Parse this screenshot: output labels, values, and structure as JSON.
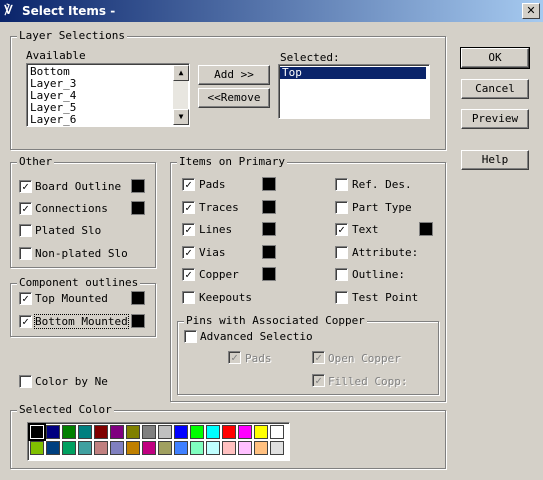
{
  "title": "Select Items -",
  "layer_selections": {
    "legend": "Layer Selections",
    "available_label": "Available",
    "available_items": [
      "Bottom",
      "Layer_3",
      "Layer_4",
      "Layer_5",
      "Layer_6"
    ],
    "selected_label": "Selected:",
    "selected_items": [
      "Top"
    ],
    "add_label": "Add >>",
    "remove_label": "<<Remove"
  },
  "buttons": {
    "ok": "OK",
    "cancel": "Cancel",
    "preview": "Preview",
    "help": "Help"
  },
  "other": {
    "legend": "Other",
    "items": [
      {
        "label": "Board Outline",
        "checked": true,
        "swatch": true
      },
      {
        "label": "Connections",
        "checked": true,
        "swatch": true
      },
      {
        "label": "Plated Slo",
        "checked": false,
        "swatch": false
      },
      {
        "label": "Non-plated Slo",
        "checked": false,
        "swatch": false
      }
    ]
  },
  "component_outlines": {
    "legend": "Component outlines",
    "items": [
      {
        "label": "Top Mounted",
        "checked": true
      },
      {
        "label": "Bottom Mounted",
        "checked": true
      }
    ]
  },
  "color_by_net": {
    "label": "Color by Ne",
    "checked": false
  },
  "items_on_primary": {
    "legend": "Items on Primary",
    "left": [
      {
        "label": "Pads",
        "checked": true
      },
      {
        "label": "Traces",
        "checked": true
      },
      {
        "label": "Lines",
        "checked": true
      },
      {
        "label": "Vias",
        "checked": true
      },
      {
        "label": "Copper",
        "checked": true
      },
      {
        "label": "Keepouts",
        "checked": false
      }
    ],
    "right": [
      {
        "label": "Ref. Des.",
        "checked": false
      },
      {
        "label": "Part Type",
        "checked": false
      },
      {
        "label": "Text",
        "checked": true
      },
      {
        "label": "Attribute:",
        "checked": false
      },
      {
        "label": "Outline:",
        "checked": false
      },
      {
        "label": "Test Point",
        "checked": false
      }
    ]
  },
  "pins_copper": {
    "legend": "Pins with Associated Copper",
    "advanced_label": "Advanced Selectio",
    "advanced_checked": false,
    "pads_label": "Pads",
    "open_copper_label": "Open Copper",
    "filled_copper_label": "Filled Copp:"
  },
  "selected_color": {
    "legend": "Selected Color",
    "row1": [
      "#000000",
      "#000080",
      "#008000",
      "#008080",
      "#800000",
      "#800080",
      "#808000",
      "#808080",
      "#c0c0c0",
      "#0000ff",
      "#00ff00",
      "#00ffff",
      "#ff0000",
      "#ff00ff",
      "#ffff00",
      "#ffffff"
    ],
    "row2": [
      "#80c000",
      "#004080",
      "#00a060",
      "#40a0a0",
      "#c08080",
      "#8080c0",
      "#c08000",
      "#c00080",
      "#a0a060",
      "#4080ff",
      "#80ffc0",
      "#c0ffff",
      "#ffc0c0",
      "#ffc0ff",
      "#ffc080",
      "#e0e0e0"
    ],
    "selected_index": 0
  }
}
